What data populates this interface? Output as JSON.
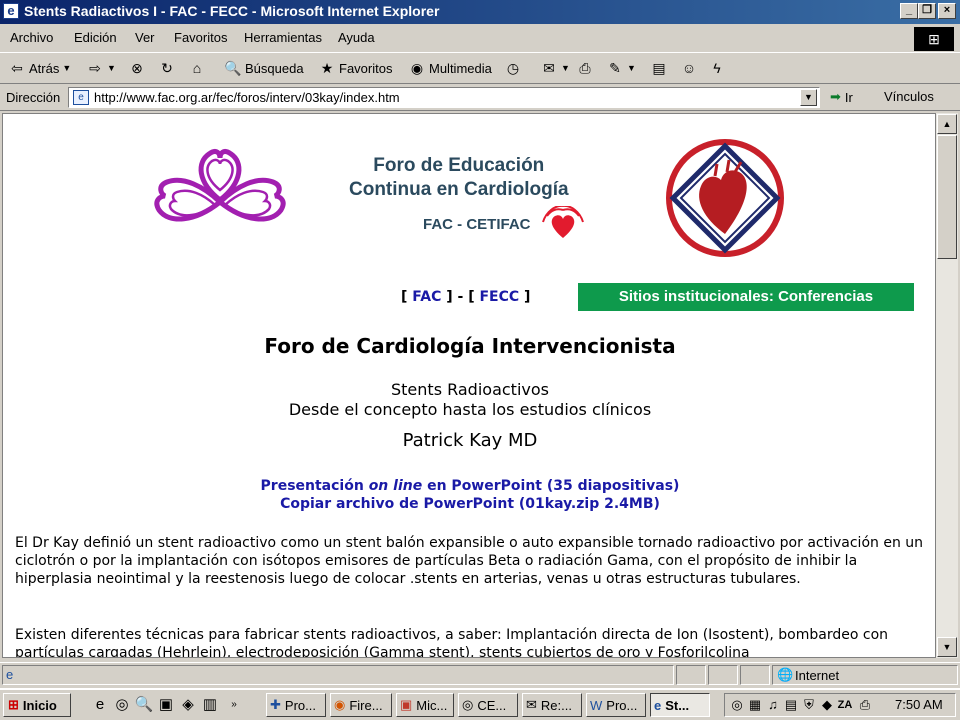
{
  "window": {
    "title": "Stents Radiactivos I - FAC - FECC - Microsoft Internet Explorer"
  },
  "menu": [
    "Archivo",
    "Edición",
    "Ver",
    "Favoritos",
    "Herramientas",
    "Ayuda"
  ],
  "toolbar": {
    "back": "Atrás",
    "search": "Búsqueda",
    "favorites": "Favoritos",
    "multimedia": "Multimedia"
  },
  "address": {
    "label": "Dirección",
    "url": "http://www.fac.org.ar/fec/foros/interv/03kay/index.htm",
    "go": "Ir",
    "links": "Vínculos"
  },
  "page": {
    "forum_line1": "Foro de Educación",
    "forum_line2": "Continua en Cardiología",
    "fac_cetifac": "FAC - CETIFAC",
    "link_open": "[",
    "link_fac": "FAC",
    "link_sep": "] - [",
    "link_fecc": "FECC",
    "link_close": "]",
    "institutional_button": "Sitios institucionales: Conferencias",
    "heading": "Foro de Cardiología Intervencionista",
    "subtitle1": "Stents Radioactivos",
    "subtitle2": "Desde el concepto hasta los estudios clínicos",
    "author": "Patrick Kay MD",
    "presentation_prefix": "Presentación ",
    "presentation_em": "on line",
    "presentation_suffix": " en PowerPoint (35 diapositivas)",
    "copy_link": "Copiar archivo de PowerPoint (01kay.zip 2.4MB)",
    "paragraph1": "El Dr Kay definió un stent radioactivo como un stent balón expansible o auto expansible tornado radioactivo por activación en un ciclotrón o por la implantación con isótopos emisores de partículas Beta o radiación Gama, con el propósito de inhibir la hiperplasia neointimal y la reestenosis luego de colocar .stents en arterias, venas u otras estructuras tubulares.",
    "paragraph2": "Existen diferentes técnicas para fabricar stents radioactivos, a saber: Implantación directa de Ion (Isostent), bombardeo con partículas cargadas (Hehrlein), electrodeposición (Gamma stent), stents cubiertos de oro y Fosforilcolina"
  },
  "status": {
    "zone": "Internet"
  },
  "taskbar": {
    "start": "Inicio",
    "tasks": [
      "Pro...",
      "Fire...",
      "Mic...",
      "CE...",
      "Re:...",
      "Pro...",
      "St..."
    ],
    "clock": "7:50 AM"
  },
  "colors": {
    "green_button": "#0e9a4c",
    "link_blue": "#1a1aa6",
    "heart_logo": "#a21fb0",
    "seal_red": "#c8202a",
    "seal_navy": "#1f2a6b"
  }
}
